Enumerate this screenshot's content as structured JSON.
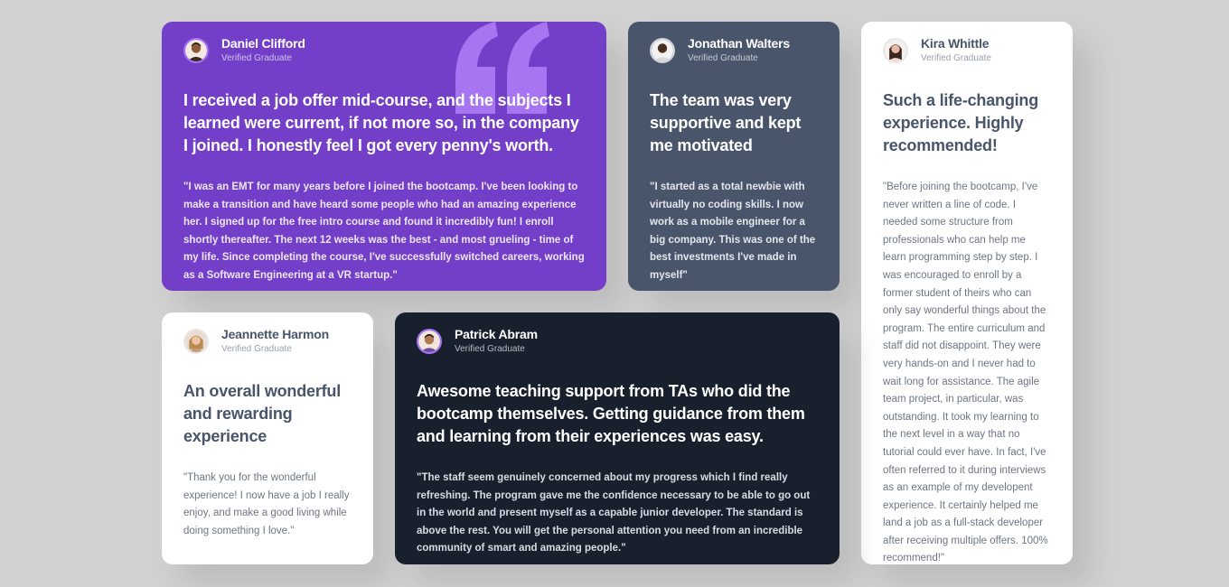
{
  "colors": {
    "page_background": "#d1d1d1",
    "violet": "#733fc8",
    "grayish_blue": "#48556a",
    "dark_blackish_blue": "#19202d",
    "white": "#ffffff",
    "quote_mark": "#a775f1"
  },
  "testimonials": [
    {
      "id": "daniel",
      "name": "Daniel Clifford",
      "role": "Verified Graduate",
      "headline": "I received a job offer mid-course, and the subjects I learned were current, if not more so, in the company I joined. I honestly feel I got every penny's worth.",
      "body": "\"I was an EMT for many years before I joined the bootcamp. I've been looking to make a transition and have heard some people who had an amazing experience her. I signed up for the free intro course and found it incredibly fun! I enroll shortly thereafter. The next 12 weeks was the best - and most grueling - time of my life. Since completing the course, I've successfully switched careers, working as a Software Engineering at a VR startup.\"",
      "card_color": "violet",
      "decoration_icon": "quotation-mark-icon"
    },
    {
      "id": "jonathan",
      "name": "Jonathan Walters",
      "role": "Verified Graduate",
      "headline": "The team was very supportive and kept me motivated",
      "body": "\"I started as a total newbie with virtually no coding skills. I now work as a mobile engineer for a big company. This was one of the best investments I've made in myself\"",
      "card_color": "grayish_blue"
    },
    {
      "id": "kira",
      "name": "Kira Whittle",
      "role": "Verified Graduate",
      "headline": "Such a life-changing experience. Highly recommended!",
      "body": "\"Before joining the bootcamp, I've never written a line of code. I needed some structure from professionals who can help me learn programming step by step. I was encouraged to enroll by a former student of theirs who can only say wonderful things about the program. The entire curriculum and staff did not disappoint. They were very hands-on and I never had to wait long for assistance. The agile team project, in particular, was outstanding. It took my learning to the next level in a way that no tutorial could ever have. In fact, I've often referred to it during interviews as an example of my developent experience. It certainly helped me land a job as a full-stack developer after receiving multiple offers. 100% recommend!\"",
      "card_color": "white"
    },
    {
      "id": "jeannette",
      "name": "Jeannette Harmon",
      "role": "Verified Graduate",
      "headline": "An overall wonderful and rewarding experience",
      "body": "\"Thank you for the wonderful experience! I now have a job I really enjoy, and make a good living while doing something I love.\"",
      "card_color": "white"
    },
    {
      "id": "patrick",
      "name": "Patrick Abram",
      "role": "Verified Graduate",
      "headline": "Awesome teaching support from TAs who did the bootcamp themselves. Getting guidance from them and learning from their experiences was easy.",
      "body": "\"The staff seem genuinely concerned about my progress which I find really refreshing. The program gave me the confidence necessary to be able to go out in the world and present myself as a capable junior developer. The standard is above the rest. You will get the personal attention you need from an incredible community of smart and amazing people.\"",
      "card_color": "dark_blackish_blue"
    }
  ]
}
